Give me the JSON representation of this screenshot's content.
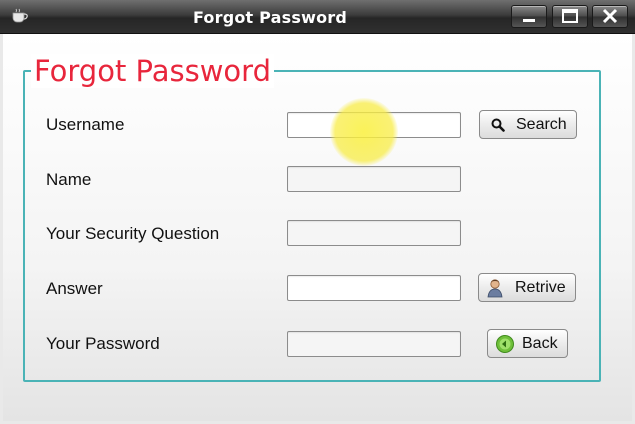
{
  "window": {
    "title": "Forgot Password",
    "icon": "coffee-cup-icon",
    "controls": [
      "minimize-icon",
      "maximize-icon",
      "close-icon"
    ]
  },
  "form": {
    "group_title": "Forgot Password",
    "fields": [
      {
        "label": "Username",
        "value": "",
        "editable": true
      },
      {
        "label": "Name",
        "value": "",
        "editable": false
      },
      {
        "label": "Your Security Question",
        "value": "",
        "editable": false
      },
      {
        "label": "Answer",
        "value": "",
        "editable": true
      },
      {
        "label": "Your Password",
        "value": "",
        "editable": false
      }
    ]
  },
  "buttons": {
    "search": {
      "label": "Search",
      "icon": "magnifier-icon"
    },
    "retrive": {
      "label": "Retrive",
      "icon": "user-icon"
    },
    "back": {
      "label": "Back",
      "icon": "back-arrow-icon"
    }
  },
  "colors": {
    "title_text": "#e8263c",
    "group_border": "#4ab3b6",
    "titlebar": "#303030"
  }
}
